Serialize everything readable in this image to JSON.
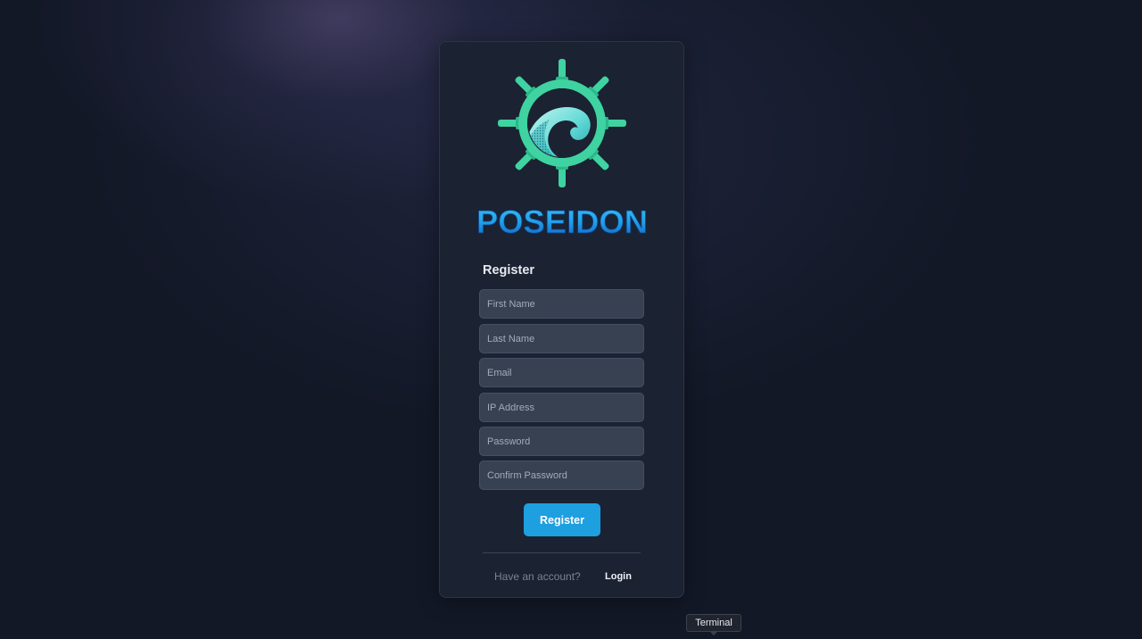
{
  "brand": {
    "name": "POSEIDON",
    "logo_icon": "ship-wheel-wave-icon",
    "colors": {
      "wheel": "#3ed3a0",
      "wheel_dark": "#2bb78a",
      "wave_light": "#b7f3ee",
      "wave_mid": "#5ed8d6",
      "wave_dark": "#1aa3a8",
      "wordmark_top": "#2fb8f0",
      "wordmark_bottom": "#1167c9"
    }
  },
  "form": {
    "title": "Register",
    "fields": {
      "first_name": {
        "placeholder": "First Name",
        "value": ""
      },
      "last_name": {
        "placeholder": "Last Name",
        "value": ""
      },
      "email": {
        "placeholder": "Email",
        "value": ""
      },
      "ip_address": {
        "placeholder": "IP Address",
        "value": ""
      },
      "password": {
        "placeholder": "Password",
        "value": ""
      },
      "confirm_password": {
        "placeholder": "Confirm Password",
        "value": ""
      }
    },
    "submit_label": "Register",
    "submit_color": "#1e9fe0"
  },
  "footer": {
    "prompt": "Have an account?",
    "login_label": "Login"
  },
  "tooltip": {
    "text": "Terminal"
  }
}
